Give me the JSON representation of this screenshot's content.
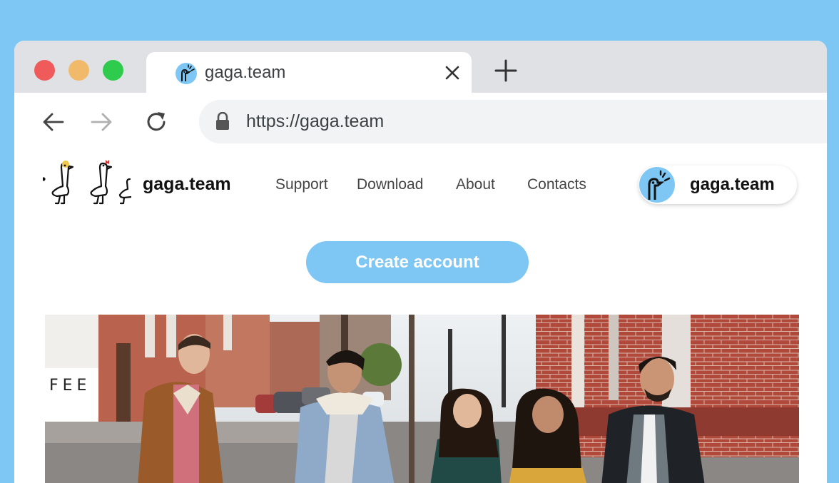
{
  "tab": {
    "title": "gaga.team",
    "favicon": "gaga-bird-icon"
  },
  "toolbar": {
    "url": "https://gaga.team"
  },
  "site": {
    "brand": "gaga.team",
    "nav": [
      "Support",
      "Download",
      "About",
      "Contacts"
    ],
    "account_pill": "gaga.team",
    "cta": "Create account",
    "hero_storefront_text": "FEE"
  },
  "colors": {
    "background": "#7ec6f3",
    "accent": "#7ec6f3",
    "close_red": "#ef5b5b",
    "minimize_yellow": "#f1b96a",
    "maximize_green": "#2fcb4c"
  }
}
